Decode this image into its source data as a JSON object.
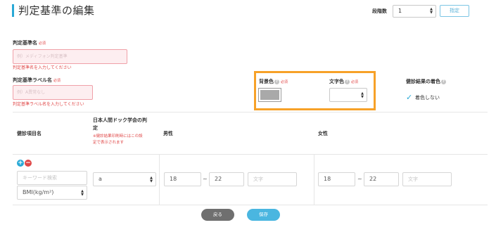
{
  "header": {
    "title": "判定基準の編集",
    "stage_label": "段階数",
    "stage_value": "1",
    "apply_label": "指定"
  },
  "form": {
    "name": {
      "label": "判定基準名",
      "required": "必須",
      "placeholder": "例）メディフォン判定基準",
      "error": "判定基準名を入力してください"
    },
    "label_name": {
      "label": "判定基準ラベル名",
      "required": "必須",
      "placeholder": "例）A異常なし",
      "error": "判定基準ラベル名を入力してください"
    },
    "bg_color": {
      "label": "背景色",
      "required": "必須",
      "value_color": "#a9a9a9"
    },
    "text_color": {
      "label": "文字色",
      "required": "必須",
      "value": ""
    },
    "result_color": {
      "label": "健診結果の着色",
      "checkbox_label": "着色しない",
      "checked": true
    }
  },
  "table": {
    "headers": {
      "item": "健診項目名",
      "society_line1": "日本人間ドック学会の判",
      "society_line2": "定",
      "society_note_line1": "※健診結果印刷時にはこの設",
      "society_note_line2": "定で表示されます",
      "male": "男性",
      "female": "女性"
    },
    "row": {
      "keyword_placeholder": "キーワード検索",
      "item_value": "BMI(kg/m²)",
      "society_value": "a",
      "male_min": "18",
      "male_max": "22",
      "male_text_placeholder": "文字",
      "female_min": "18",
      "female_max": "22",
      "female_text_placeholder": "文字",
      "tilde": "~"
    }
  },
  "footer": {
    "back_label": "戻る",
    "save_label": "保存"
  },
  "colors": {
    "accent": "#29a9d6",
    "highlight": "#f7a128",
    "error": "#e04848"
  }
}
